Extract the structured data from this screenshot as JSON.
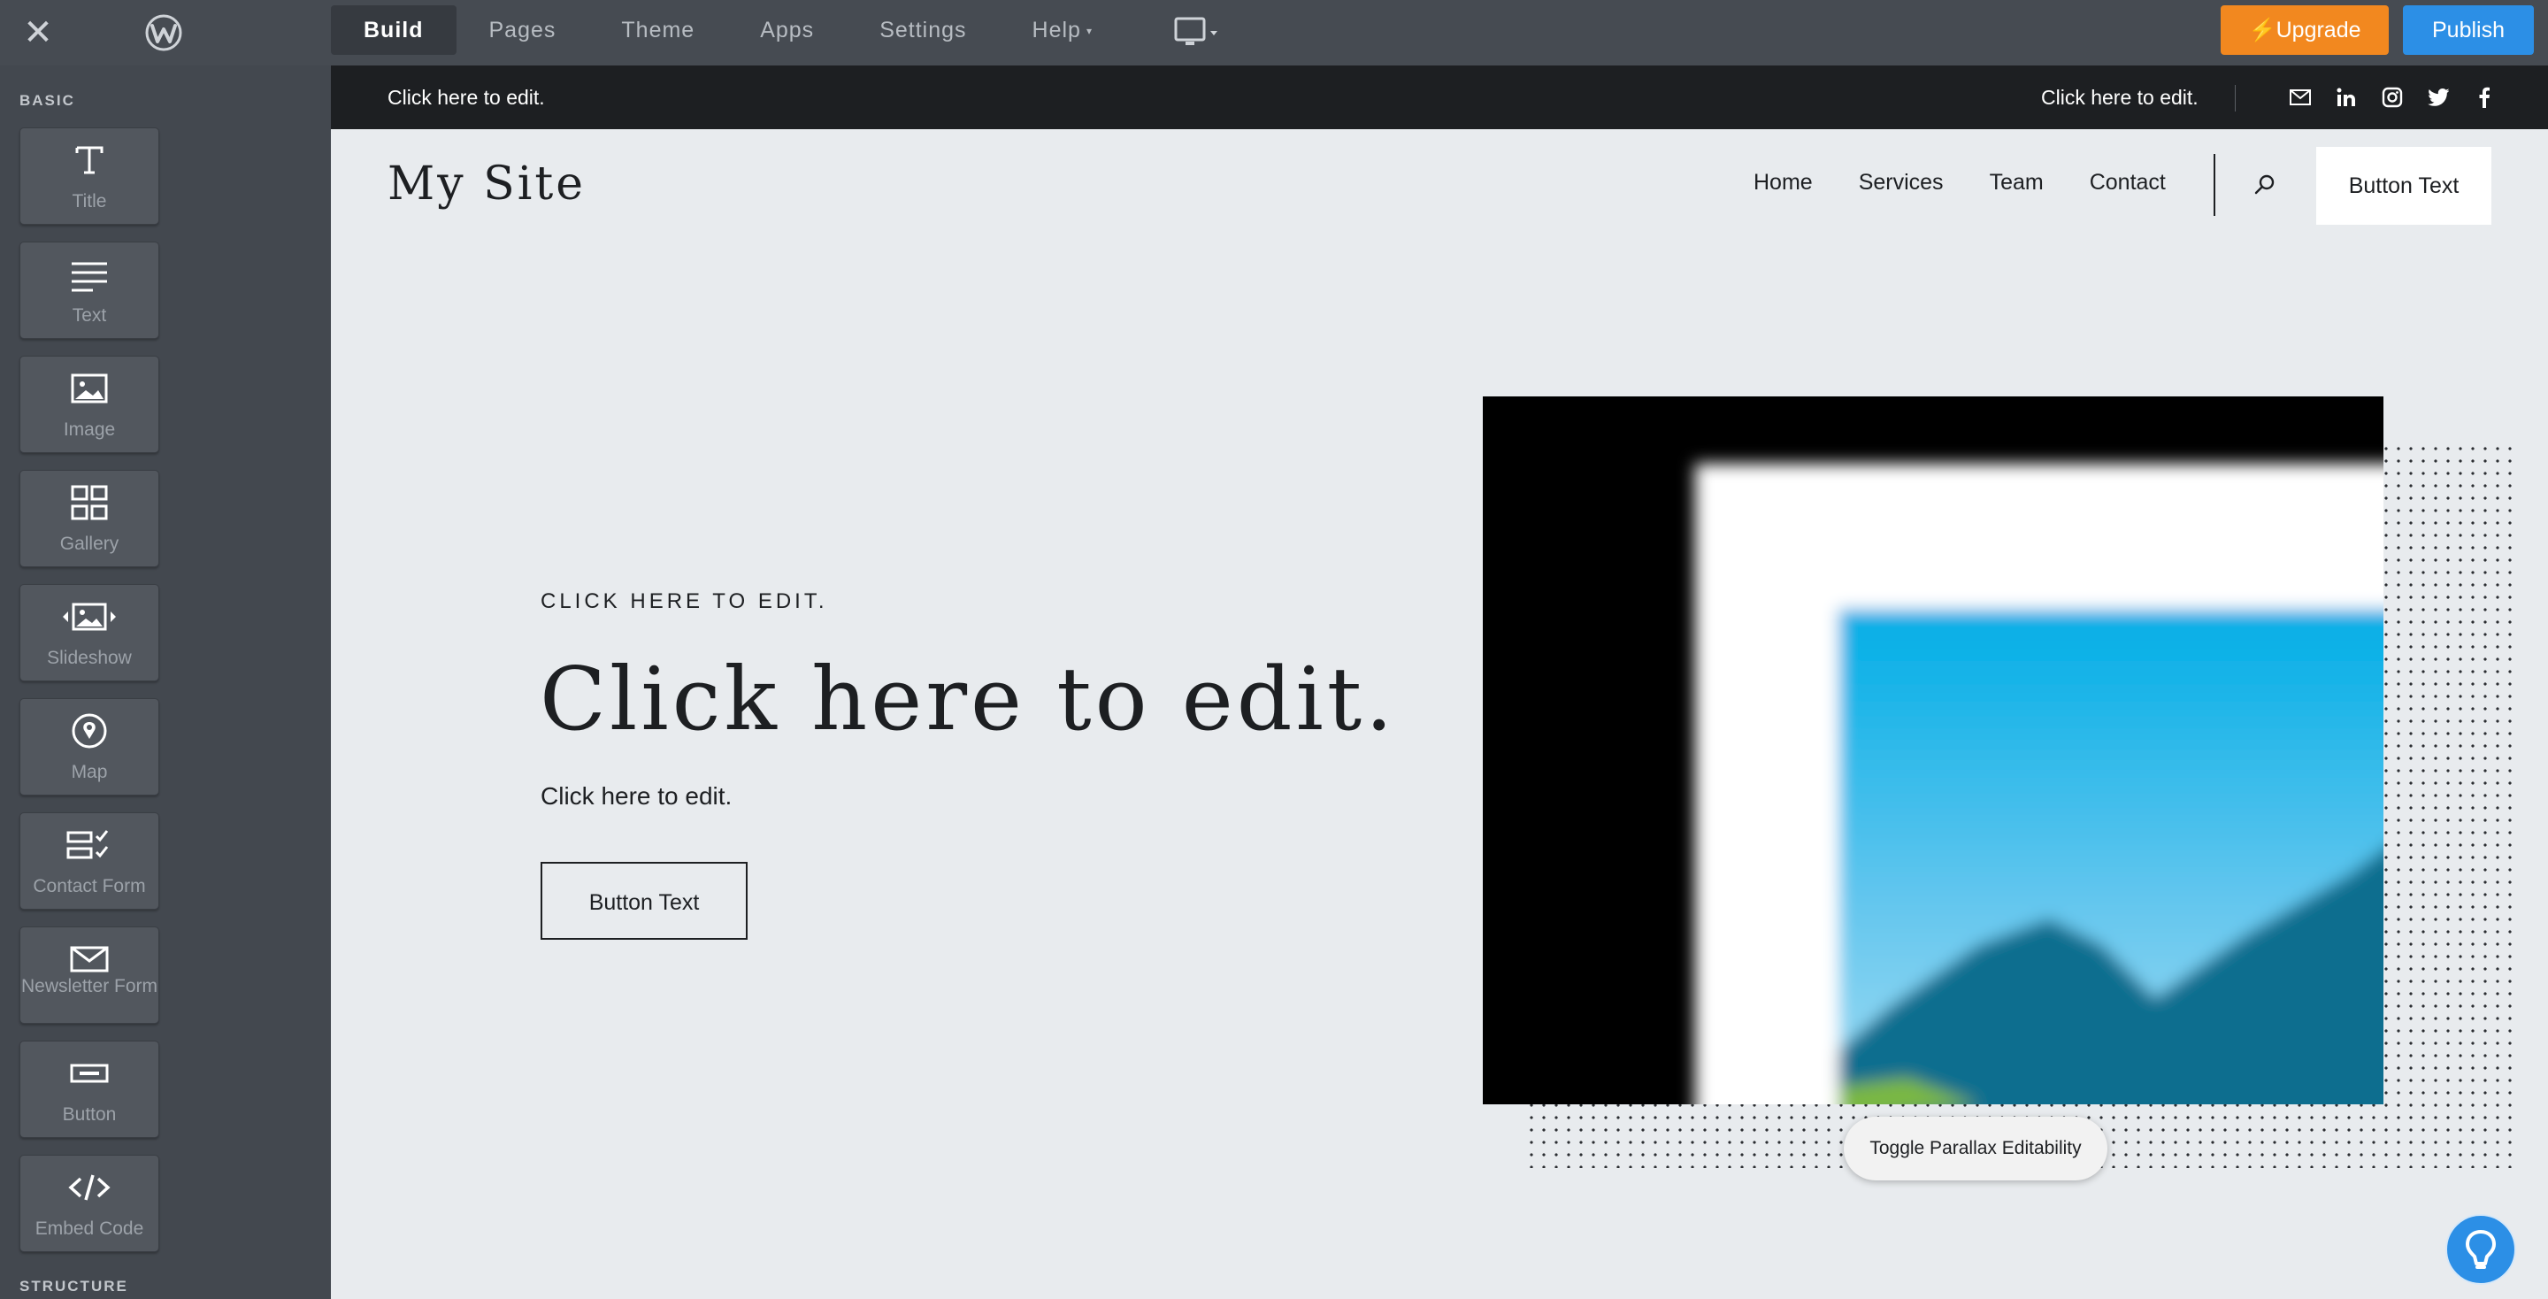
{
  "topbar": {
    "close_icon": "close-icon",
    "logo_icon": "weebly-logo-icon",
    "tabs": [
      {
        "label": "Build",
        "active": true
      },
      {
        "label": "Pages"
      },
      {
        "label": "Theme"
      },
      {
        "label": "Apps"
      },
      {
        "label": "Settings"
      },
      {
        "label": "Help",
        "has_dropdown": true
      }
    ],
    "device_icon": "desktop-monitor-icon",
    "upgrade_label": "Upgrade",
    "publish_label": "Publish",
    "colors": {
      "bar": "#464b52",
      "upgrade": "#f2881f",
      "publish": "#2c8fe6"
    }
  },
  "sidebar": {
    "section_basic": "BASIC",
    "section_structure": "STRUCTURE",
    "items": [
      {
        "label": "Title",
        "icon": "title-icon"
      },
      {
        "label": "Text",
        "icon": "text-icon"
      },
      {
        "label": "Image",
        "icon": "image-icon"
      },
      {
        "label": "Gallery",
        "icon": "gallery-icon"
      },
      {
        "label": "Slideshow",
        "icon": "slideshow-icon"
      },
      {
        "label": "Map",
        "icon": "map-pin-icon"
      },
      {
        "label": "Contact Form",
        "icon": "contact-form-icon"
      },
      {
        "label": "Newsletter Form",
        "icon": "envelope-icon"
      },
      {
        "label": "Button",
        "icon": "button-icon"
      },
      {
        "label": "Embed Code",
        "icon": "code-icon"
      }
    ]
  },
  "site": {
    "topbar_left_text": "Click here to edit.",
    "topbar_right_text": "Click here to edit.",
    "social_icons": [
      "mail-icon",
      "linkedin-icon",
      "instagram-icon",
      "twitter-icon",
      "facebook-icon"
    ],
    "title": "My Site",
    "nav": [
      "Home",
      "Services",
      "Team",
      "Contact"
    ],
    "header_button": "Button Text",
    "hero": {
      "eyebrow": "CLICK HERE TO EDIT.",
      "title": "Click here to edit.",
      "subtitle": "Click here to edit.",
      "button": "Button Text"
    },
    "parallax_toggle": "Toggle Parallax Editability"
  }
}
